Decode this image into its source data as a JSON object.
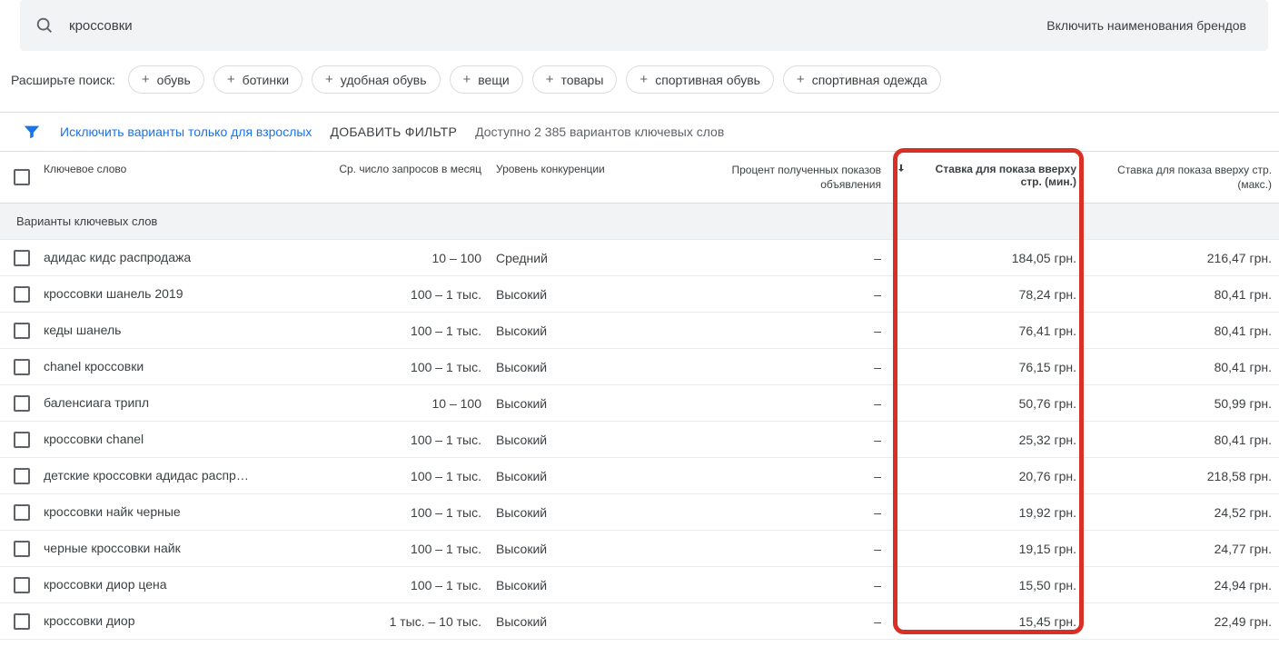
{
  "search": {
    "value": "кроссовки",
    "brand_toggle": "Включить наименования брендов"
  },
  "expand": {
    "label": "Расширьте поиск:",
    "chips": [
      "обувь",
      "ботинки",
      "удобная обувь",
      "вещи",
      "товары",
      "спортивная обувь",
      "спортивная одежда"
    ]
  },
  "filters": {
    "exclude_adult": "Исключить варианты только для взрослых",
    "add_filter": "ДОБАВИТЬ ФИЛЬТР",
    "available": "Доступно 2 385 вариантов ключевых слов"
  },
  "columns": {
    "keyword": "Ключевое слово",
    "monthly": "Ср. число запросов в месяц",
    "competition": "Уровень конкуренции",
    "impressions": "Процент полученных показов объявления",
    "bid_min": "Ставка для показа вверху стр. (мин.)",
    "bid_max": "Ставка для показа вверху стр. (макс.)"
  },
  "section_title": "Варианты ключевых слов",
  "rows": [
    {
      "keyword": "адидас кидс распродажа",
      "monthly": "10 – 100",
      "competition": "Средний",
      "impressions": "–",
      "bid_min": "184,05 грн.",
      "bid_max": "216,47 грн."
    },
    {
      "keyword": "кроссовки шанель 2019",
      "monthly": "100 – 1 тыс.",
      "competition": "Высокий",
      "impressions": "–",
      "bid_min": "78,24 грн.",
      "bid_max": "80,41 грн."
    },
    {
      "keyword": "кеды шанель",
      "monthly": "100 – 1 тыс.",
      "competition": "Высокий",
      "impressions": "–",
      "bid_min": "76,41 грн.",
      "bid_max": "80,41 грн."
    },
    {
      "keyword": "chanel кроссовки",
      "monthly": "100 – 1 тыс.",
      "competition": "Высокий",
      "impressions": "–",
      "bid_min": "76,15 грн.",
      "bid_max": "80,41 грн."
    },
    {
      "keyword": "баленсиага трипл",
      "monthly": "10 – 100",
      "competition": "Высокий",
      "impressions": "–",
      "bid_min": "50,76 грн.",
      "bid_max": "50,99 грн."
    },
    {
      "keyword": "кроссовки chanel",
      "monthly": "100 – 1 тыс.",
      "competition": "Высокий",
      "impressions": "–",
      "bid_min": "25,32 грн.",
      "bid_max": "80,41 грн."
    },
    {
      "keyword": "детские кроссовки адидас распр…",
      "monthly": "100 – 1 тыс.",
      "competition": "Высокий",
      "impressions": "–",
      "bid_min": "20,76 грн.",
      "bid_max": "218,58 грн."
    },
    {
      "keyword": "кроссовки найк черные",
      "monthly": "100 – 1 тыс.",
      "competition": "Высокий",
      "impressions": "–",
      "bid_min": "19,92 грн.",
      "bid_max": "24,52 грн."
    },
    {
      "keyword": "черные кроссовки найк",
      "monthly": "100 – 1 тыс.",
      "competition": "Высокий",
      "impressions": "–",
      "bid_min": "19,15 грн.",
      "bid_max": "24,77 грн."
    },
    {
      "keyword": "кроссовки диор цена",
      "monthly": "100 – 1 тыс.",
      "competition": "Высокий",
      "impressions": "–",
      "bid_min": "15,50 грн.",
      "bid_max": "24,94 грн."
    },
    {
      "keyword": "кроссовки диор",
      "monthly": "1 тыс. – 10 тыс.",
      "competition": "Высокий",
      "impressions": "–",
      "bid_min": "15,45 грн.",
      "bid_max": "22,49 грн."
    }
  ]
}
